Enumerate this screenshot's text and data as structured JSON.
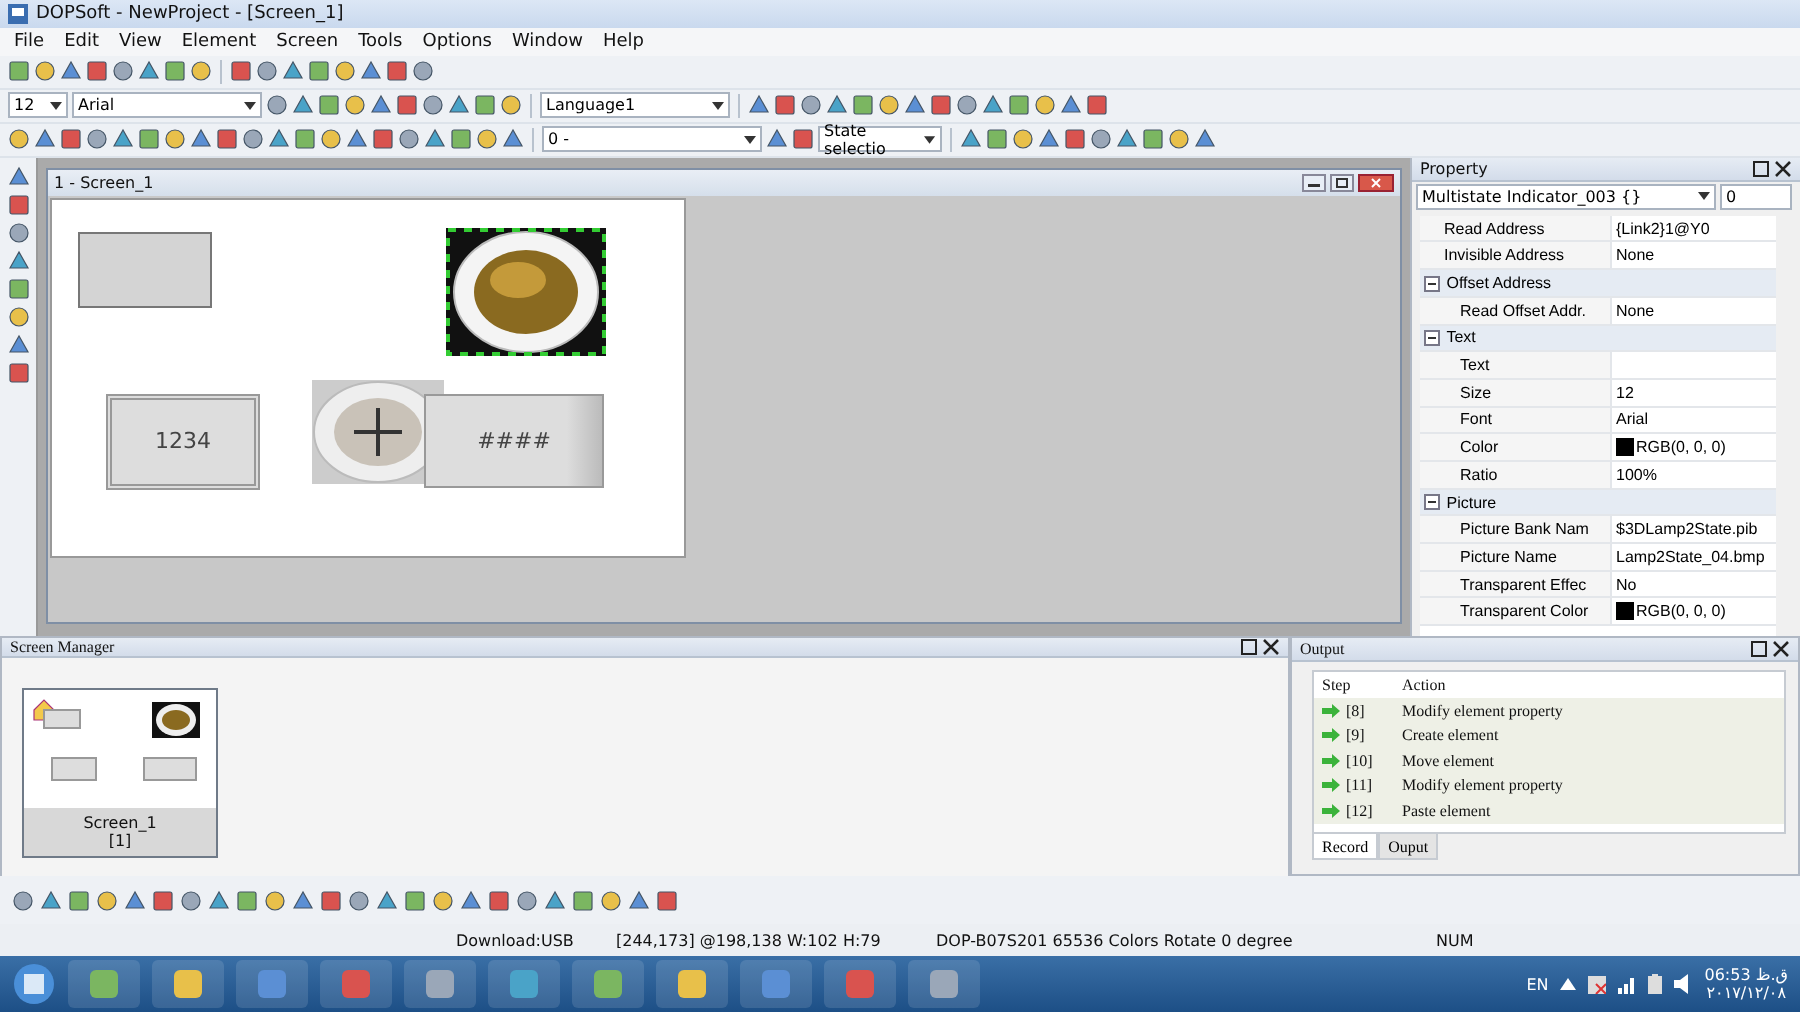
{
  "window": {
    "title": "DOPSoft - NewProject - [Screen_1]"
  },
  "menu": [
    "File",
    "Edit",
    "View",
    "Element",
    "Screen",
    "Tools",
    "Options",
    "Window",
    "Help"
  ],
  "format_bar": {
    "font_size": "12",
    "font": "Arial",
    "language": "Language1"
  },
  "element_bar": {
    "state_value": "0 -",
    "state_selection": "State selectio"
  },
  "screen_window": {
    "title": "1 - Screen_1",
    "elements": [
      {
        "kind": "button"
      },
      {
        "kind": "lamp",
        "selected": true
      },
      {
        "kind": "numeric",
        "text": "1234"
      },
      {
        "kind": "round_button"
      },
      {
        "kind": "character",
        "text": "####"
      }
    ]
  },
  "properties": {
    "title": "Property",
    "selector": "Multistate Indicator_003 {}",
    "spin": "0",
    "rows": [
      {
        "kind": "prop",
        "name": "Read Address",
        "value": "{Link2}1@Y0"
      },
      {
        "kind": "prop",
        "name": "Invisible Address",
        "value": "None"
      },
      {
        "kind": "group",
        "name": "Offset Address",
        "expanded": true
      },
      {
        "kind": "sub",
        "name": "Read Offset Addr.",
        "value": "None"
      },
      {
        "kind": "group",
        "name": "Text",
        "expanded": true
      },
      {
        "kind": "sub",
        "name": "Text",
        "value": ""
      },
      {
        "kind": "sub",
        "name": "Size",
        "value": "12"
      },
      {
        "kind": "sub",
        "name": "Font",
        "value": "Arial"
      },
      {
        "kind": "sub",
        "name": "Color",
        "value": "RGB(0, 0, 0)",
        "color": "#000000"
      },
      {
        "kind": "sub",
        "name": "Ratio",
        "value": "100%"
      },
      {
        "kind": "group",
        "name": "Picture",
        "expanded": true
      },
      {
        "kind": "sub",
        "name": "Picture Bank Nam",
        "value": "$3DLamp2State.pib"
      },
      {
        "kind": "sub",
        "name": "Picture Name",
        "value": "Lamp2State_04.bmp"
      },
      {
        "kind": "sub",
        "name": "Transparent Effec",
        "value": "No"
      },
      {
        "kind": "sub",
        "name": "Transparent Color",
        "value": "RGB(0, 0, 0)",
        "color": "#000000"
      }
    ]
  },
  "screen_manager": {
    "title": "Screen Manager",
    "screens": [
      {
        "name": "Screen_1",
        "number": "[1]",
        "selected": true
      }
    ]
  },
  "output": {
    "title": "Output",
    "columns": [
      "Step",
      "Action"
    ],
    "rows": [
      {
        "step": "[8]",
        "action": "Modify element property"
      },
      {
        "step": "[9]",
        "action": "Create element"
      },
      {
        "step": "[10]",
        "action": "Move element"
      },
      {
        "step": "[11]",
        "action": "Modify element property"
      },
      {
        "step": "[12]",
        "action": "Paste element"
      }
    ],
    "tabs": [
      {
        "label": "Record",
        "selected": true
      },
      {
        "label": "Ouput",
        "selected": false
      }
    ]
  },
  "status_bar": [
    "Download:USB",
    "[244,173] @198,138 W:102 H:79",
    "DOP-B07S201 65536 Colors Rotate 0 degree",
    "NUM"
  ],
  "taskbar": {
    "language": "EN",
    "time": "06:53 ق.ظ",
    "date": "۲۰۱۷/۱۲/۰۸"
  }
}
